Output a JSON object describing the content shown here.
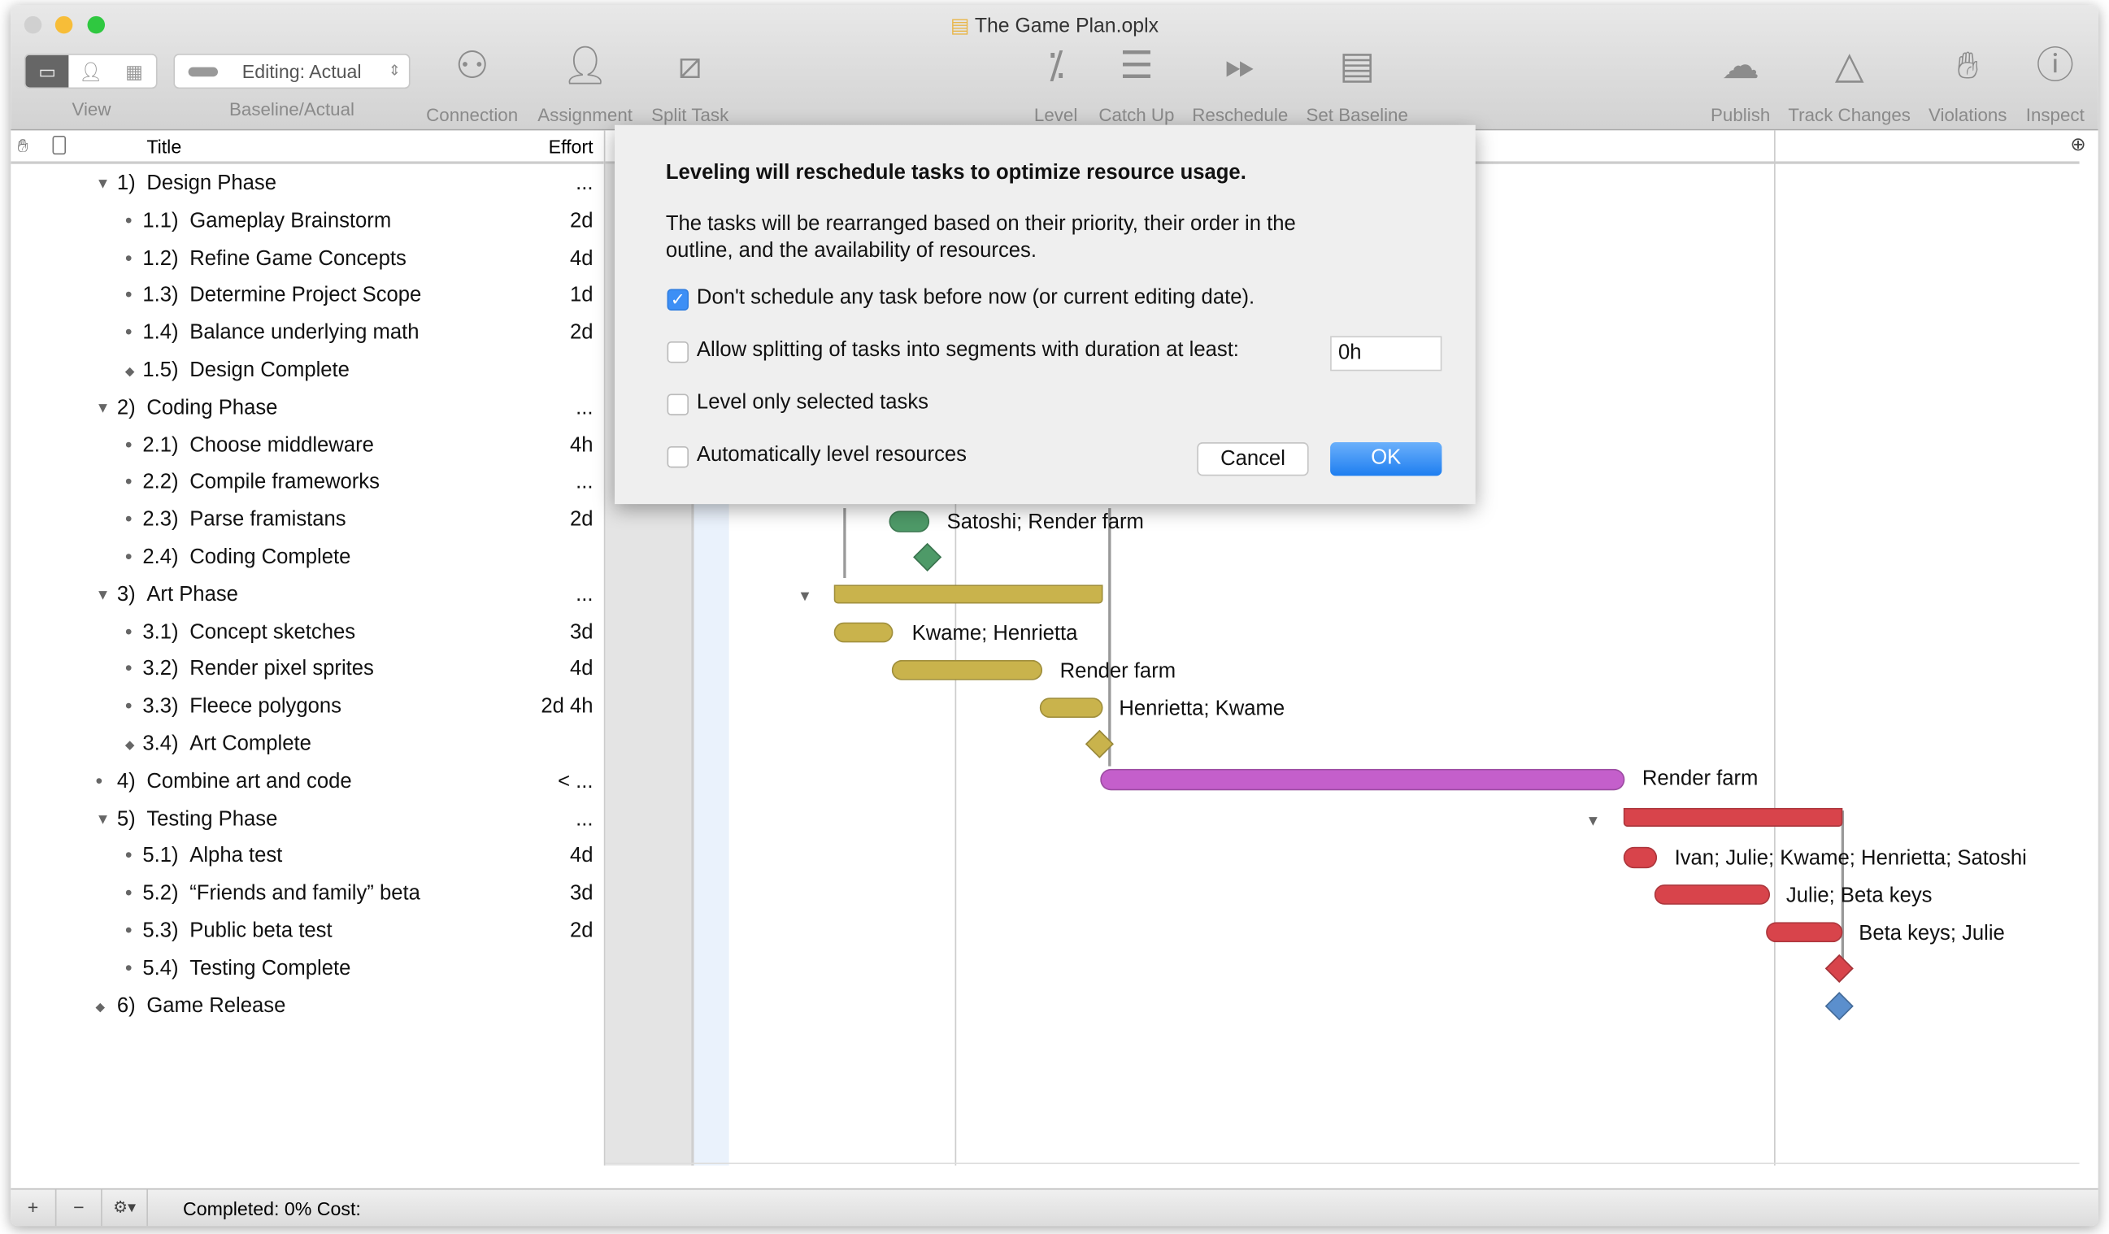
{
  "window": {
    "title": "The Game Plan.oplx"
  },
  "toolbar": {
    "view_label": "View",
    "baseline_label": "Baseline/Actual",
    "baseline_value": "Editing: Actual",
    "items": [
      {
        "label": "Connection",
        "icon": "connection-icon"
      },
      {
        "label": "Assignment",
        "icon": "person-icon"
      },
      {
        "label": "Split Task",
        "icon": "split-task-icon"
      },
      {
        "label": "Level",
        "icon": "level-icon"
      },
      {
        "label": "Catch Up",
        "icon": "catch-up-icon"
      },
      {
        "label": "Reschedule",
        "icon": "reschedule-icon"
      },
      {
        "label": "Set Baseline",
        "icon": "baseline-icon"
      },
      {
        "label": "Publish",
        "icon": "cloud-upload-icon"
      },
      {
        "label": "Track Changes",
        "icon": "delta-icon"
      },
      {
        "label": "Violations",
        "icon": "stop-hand-icon"
      },
      {
        "label": "Inspect",
        "icon": "info-icon"
      }
    ]
  },
  "outline": {
    "columns": {
      "title": "Title",
      "effort": "Effort"
    },
    "rows": [
      {
        "num": "1)",
        "title": "Design Phase",
        "effort": "...",
        "level": 0,
        "kind": "group"
      },
      {
        "num": "1.1)",
        "title": "Gameplay Brainstorm",
        "effort": "2d",
        "level": 1,
        "kind": "task"
      },
      {
        "num": "1.2)",
        "title": "Refine Game Concepts",
        "effort": "4d",
        "level": 1,
        "kind": "task"
      },
      {
        "num": "1.3)",
        "title": "Determine Project Scope",
        "effort": "1d",
        "level": 1,
        "kind": "task"
      },
      {
        "num": "1.4)",
        "title": "Balance underlying math",
        "effort": "2d",
        "level": 1,
        "kind": "task"
      },
      {
        "num": "1.5)",
        "title": "Design Complete",
        "effort": "",
        "level": 1,
        "kind": "milestone"
      },
      {
        "num": "2)",
        "title": "Coding Phase",
        "effort": "...",
        "level": 0,
        "kind": "group"
      },
      {
        "num": "2.1)",
        "title": "Choose middleware",
        "effort": "4h",
        "level": 1,
        "kind": "task"
      },
      {
        "num": "2.2)",
        "title": "Compile frameworks",
        "effort": "...",
        "level": 1,
        "kind": "task"
      },
      {
        "num": "2.3)",
        "title": "Parse framistans",
        "effort": "2d",
        "level": 1,
        "kind": "task"
      },
      {
        "num": "2.4)",
        "title": "Coding Complete",
        "effort": "",
        "level": 1,
        "kind": "task"
      },
      {
        "num": "3)",
        "title": "Art Phase",
        "effort": "...",
        "level": 0,
        "kind": "group"
      },
      {
        "num": "3.1)",
        "title": "Concept sketches",
        "effort": "3d",
        "level": 1,
        "kind": "task"
      },
      {
        "num": "3.2)",
        "title": "Render pixel sprites",
        "effort": "4d",
        "level": 1,
        "kind": "task"
      },
      {
        "num": "3.3)",
        "title": "Fleece polygons",
        "effort": "2d 4h",
        "level": 1,
        "kind": "task"
      },
      {
        "num": "3.4)",
        "title": "Art Complete",
        "effort": "",
        "level": 1,
        "kind": "milestone"
      },
      {
        "num": "4)",
        "title": "Combine art and code",
        "effort": "< ...",
        "level": 0,
        "kind": "task"
      },
      {
        "num": "5)",
        "title": "Testing Phase",
        "effort": "...",
        "level": 0,
        "kind": "group"
      },
      {
        "num": "5.1)",
        "title": "Alpha test",
        "effort": "4d",
        "level": 1,
        "kind": "task"
      },
      {
        "num": "5.2)",
        "title": "“Friends and family” beta",
        "effort": "3d",
        "level": 1,
        "kind": "task"
      },
      {
        "num": "5.3)",
        "title": "Public beta test",
        "effort": "2d",
        "level": 1,
        "kind": "task"
      },
      {
        "num": "5.4)",
        "title": "Testing Complete",
        "effort": "",
        "level": 1,
        "kind": "task"
      },
      {
        "num": "6)",
        "title": "Game Release",
        "effort": "",
        "level": 0,
        "kind": "milestone"
      }
    ]
  },
  "gantt": {
    "labels": {
      "coding": "Satoshi; Render farm",
      "art1": "Kwame; Henrietta",
      "art2": "Render farm",
      "art3": "Henrietta; Kwame",
      "combine": "Render farm",
      "test1": "Ivan; Julie; Kwame; Henrietta; Satoshi",
      "test2": "Julie; Beta keys",
      "test3": "Beta keys; Julie"
    },
    "colors": {
      "coding": "#4e9a68",
      "art": "#c9b34c",
      "combine": "#c45fcb",
      "testing": "#d8444b",
      "release": "#5b8fcd"
    }
  },
  "dialog": {
    "heading": "Leveling will reschedule tasks to optimize resource usage.",
    "body_line1": "The tasks will be rearranged based on their priority, their order in the",
    "body_line2": "outline, and the availability of resources.",
    "options": [
      {
        "label": "Don't schedule any task before now (or current editing date).",
        "checked": true
      },
      {
        "label": "Allow splitting of tasks into segments with duration at least:",
        "checked": false
      },
      {
        "label": "Level only selected tasks",
        "checked": false
      },
      {
        "label": "Automatically level resources",
        "checked": false
      }
    ],
    "split_value": "0h",
    "cancel": "Cancel",
    "ok": "OK"
  },
  "status": {
    "text": "Completed: 0% Cost:",
    "add": "+",
    "remove": "−",
    "gear": "⚙▾"
  }
}
